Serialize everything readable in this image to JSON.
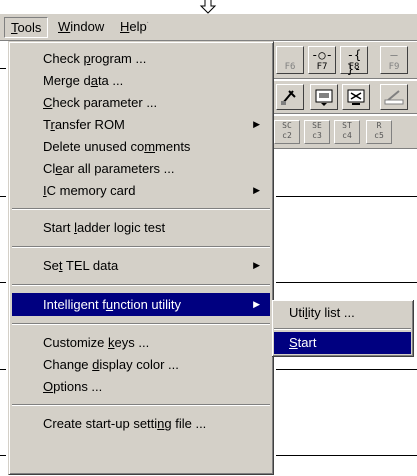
{
  "menubar": {
    "items": [
      {
        "label": "Tools",
        "u": "T",
        "rest": "ools"
      },
      {
        "label": "Window",
        "u": "W",
        "rest": "indow"
      },
      {
        "label": "Help",
        "u": "H",
        "rest": "elp"
      }
    ]
  },
  "toolbar": {
    "fkeys": [
      {
        "label": "F6",
        "symbol": ""
      },
      {
        "label": "F7",
        "symbol": "-○-"
      },
      {
        "label": "F8",
        "symbol": "-{ }-"
      },
      {
        "label": "F9",
        "symbol": "—"
      }
    ],
    "small_keys": [
      "c2",
      "c3",
      "c4",
      "c5"
    ],
    "small_key_tops": [
      "SC",
      "SE",
      "ST",
      "R"
    ]
  },
  "tools_menu": {
    "items": [
      {
        "pre": "Check ",
        "u": "p",
        "post": "rogram ...",
        "arrow": false
      },
      {
        "pre": "Merge d",
        "u": "a",
        "post": "ta ...",
        "arrow": false
      },
      {
        "pre": "",
        "u": "C",
        "post": "heck parameter ...",
        "arrow": false
      },
      {
        "pre": "T",
        "u": "r",
        "post": "ansfer ROM",
        "arrow": true
      },
      {
        "pre": "Delete unused co",
        "u": "m",
        "post": "ments",
        "arrow": false
      },
      {
        "pre": "Cl",
        "u": "e",
        "post": "ar all parameters ...",
        "arrow": false
      },
      {
        "pre": "",
        "u": "I",
        "post": "C memory card",
        "arrow": true
      },
      {
        "pre": "Start ",
        "u": "l",
        "post": "adder logic test",
        "arrow": false
      },
      {
        "pre": "Se",
        "u": "t",
        "post": " TEL data",
        "arrow": true
      },
      {
        "pre": "Intelligent f",
        "u": "u",
        "post": "nction utility",
        "arrow": true
      },
      {
        "pre": "Customize ",
        "u": "k",
        "post": "eys ...",
        "arrow": false
      },
      {
        "pre": "Change ",
        "u": "d",
        "post": "isplay color ...",
        "arrow": false
      },
      {
        "pre": "",
        "u": "O",
        "post": "ptions ...",
        "arrow": false
      },
      {
        "pre": "Create start-up setti",
        "u": "n",
        "post": "g file ...",
        "arrow": false
      }
    ]
  },
  "submenu": {
    "items": [
      {
        "pre": "Uti",
        "u": "l",
        "post": "ity list ..."
      },
      {
        "pre": "",
        "u": "S",
        "post": "tart"
      }
    ]
  },
  "colors": {
    "menu_bg": "#d4d0c8",
    "highlight": "#000080",
    "highlight_text": "#ffffff"
  }
}
